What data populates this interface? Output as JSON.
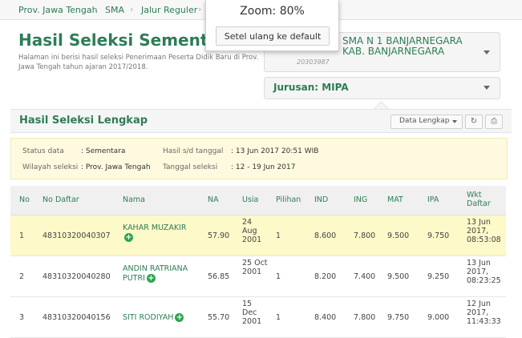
{
  "breadcrumb": [
    "Prov. Jawa Tengah",
    "SMA",
    "Jalur Reguler"
  ],
  "zoom": {
    "label": "Zoom: 80%",
    "reset_label": "Setel ulang ke default"
  },
  "page": {
    "title": "Hasil Seleksi Sementara",
    "description": "Halaman ini berisi hasil seleksi Penerimaan Peserta Didik Baru di Prov. Jawa Tengah tahun ajaran 2017/2018."
  },
  "school_select": {
    "name": "SMA N 1 BANJARNEGARA KAB. BANJARNEGARA",
    "code": "20303987"
  },
  "jurusan_select": {
    "label": "Jurusan: MIPA"
  },
  "section": {
    "title": "Hasil Seleksi Lengkap",
    "data_button": "Data Lengkap"
  },
  "status": {
    "status_label": "Status data",
    "status_value": ": Sementara",
    "hasil_label": "Hasil s/d tanggal",
    "hasil_value": ": 13 Jun 2017 20:51 WIB",
    "wilayah_label": "Wilayah seleksi",
    "wilayah_value": ": Prov. Jawa Tengah",
    "tanggal_label": "Tanggal seleksi",
    "tanggal_value": ": 12 - 19 Jun 2017"
  },
  "table": {
    "headers": {
      "no": "No",
      "no_daftar": "No Daftar",
      "nama": "Nama",
      "na": "NA",
      "usia": "Usia",
      "pilihan": "Pilihan",
      "ind": "IND",
      "ing": "ING",
      "mat": "MAT",
      "ipa": "IPA",
      "wkt": "Wkt Daftar"
    },
    "rows": [
      {
        "no": "1",
        "no_daftar": "48310320040307",
        "nama": "KAHAR MUZAKIR",
        "na": "57.90",
        "usia": "24 Aug 2001",
        "pilihan": "1",
        "ind": "8.600",
        "ing": "7.800",
        "mat": "9.500",
        "ipa": "9.750",
        "wkt": "13 Jun 2017, 08:53:08"
      },
      {
        "no": "2",
        "no_daftar": "48310320040280",
        "nama": "ANDIN RATRIANA PUTRI",
        "na": "56.85",
        "usia": "25 Oct 2001",
        "pilihan": "1",
        "ind": "8.200",
        "ing": "7.400",
        "mat": "9.500",
        "ipa": "9.250",
        "wkt": "13 Jun 2017, 08:23:25"
      },
      {
        "no": "3",
        "no_daftar": "48310320040156",
        "nama": "SITI RODIYAH",
        "na": "55.70",
        "usia": "15 Dec 2001",
        "pilihan": "1",
        "ind": "8.400",
        "ing": "7.800",
        "mat": "9.750",
        "ipa": "9.000",
        "wkt": "12 Jun 2017, 11:43:33"
      }
    ]
  }
}
